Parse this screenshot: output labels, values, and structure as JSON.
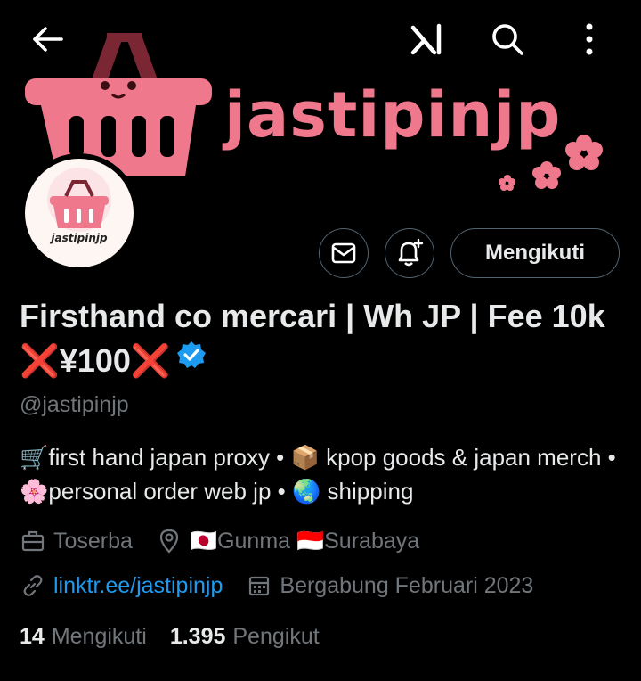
{
  "banner": {
    "brand_text": "jastipinjp",
    "avatar_text": "jastipinjp"
  },
  "topbar": {
    "back": "back",
    "grok": "grok",
    "search": "search",
    "more": "more"
  },
  "actions": {
    "follow_label": "Mengikuti"
  },
  "profile": {
    "name": "Firsthand co mercari | Wh JP | Fee 10k ❌¥100❌",
    "handle": "@jastipinjp",
    "bio": "🛒first hand japan proxy • 📦 kpop goods & japan merch • 🌸personal order web jp • 🌏 shipping",
    "category": "Toserba",
    "location": "🇯🇵Gunma 🇮🇩Surabaya",
    "link": "linktr.ee/jastipinjp",
    "joined": "Bergabung Februari 2023"
  },
  "stats": {
    "following_count": "14",
    "following_label": "Mengikuti",
    "followers_count": "1.395",
    "followers_label": "Pengikut"
  },
  "colors": {
    "accent": "#1d9bf0",
    "brand_pink": "#f0788c",
    "muted": "#71767b"
  }
}
